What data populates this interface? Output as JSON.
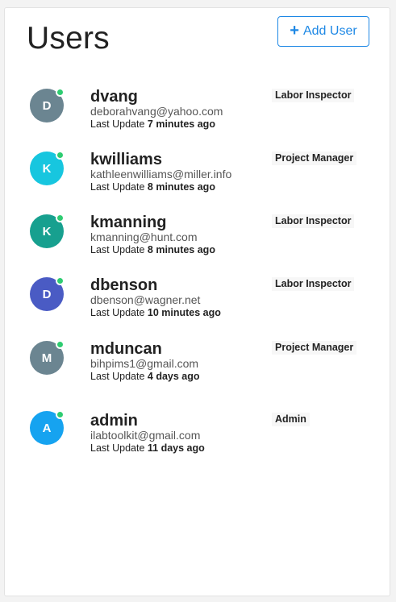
{
  "header": {
    "title": "Users",
    "add_button_label": "Add User"
  },
  "users": [
    {
      "initial": "D",
      "username": "dvang",
      "email": "deborahvang@yahoo.com",
      "last_update_label": "Last Update",
      "last_update_value": "7 minutes ago",
      "role": "Labor Inspector",
      "avatar_color": "#6b8591",
      "online": true
    },
    {
      "initial": "K",
      "username": "kwilliams",
      "email": "kathleenwilliams@miller.info",
      "last_update_label": "Last Update",
      "last_update_value": "8 minutes ago",
      "role": "Project Manager",
      "avatar_color": "#17c6df",
      "online": true
    },
    {
      "initial": "K",
      "username": "kmanning",
      "email": "kmanning@hunt.com",
      "last_update_label": "Last Update",
      "last_update_value": "8 minutes ago",
      "role": "Labor Inspector",
      "avatar_color": "#17a08f",
      "online": true
    },
    {
      "initial": "D",
      "username": "dbenson",
      "email": "dbenson@wagner.net",
      "last_update_label": "Last Update",
      "last_update_value": "10 minutes ago",
      "role": "Labor Inspector",
      "avatar_color": "#4a5bc4",
      "online": true
    },
    {
      "initial": "M",
      "username": "mduncan",
      "email": "bihpims1@gmail.com",
      "last_update_label": "Last Update",
      "last_update_value": "4 days ago",
      "role": "Project Manager",
      "avatar_color": "#6b8591",
      "online": true
    },
    {
      "initial": "A",
      "username": "admin",
      "email": "ilabtoolkit@gmail.com",
      "last_update_label": "Last Update",
      "last_update_value": "11 days ago",
      "role": "Admin",
      "avatar_color": "#16a3f0",
      "online": true
    }
  ],
  "colors": {
    "accent": "#1e88e5",
    "online": "#2ecc71"
  }
}
